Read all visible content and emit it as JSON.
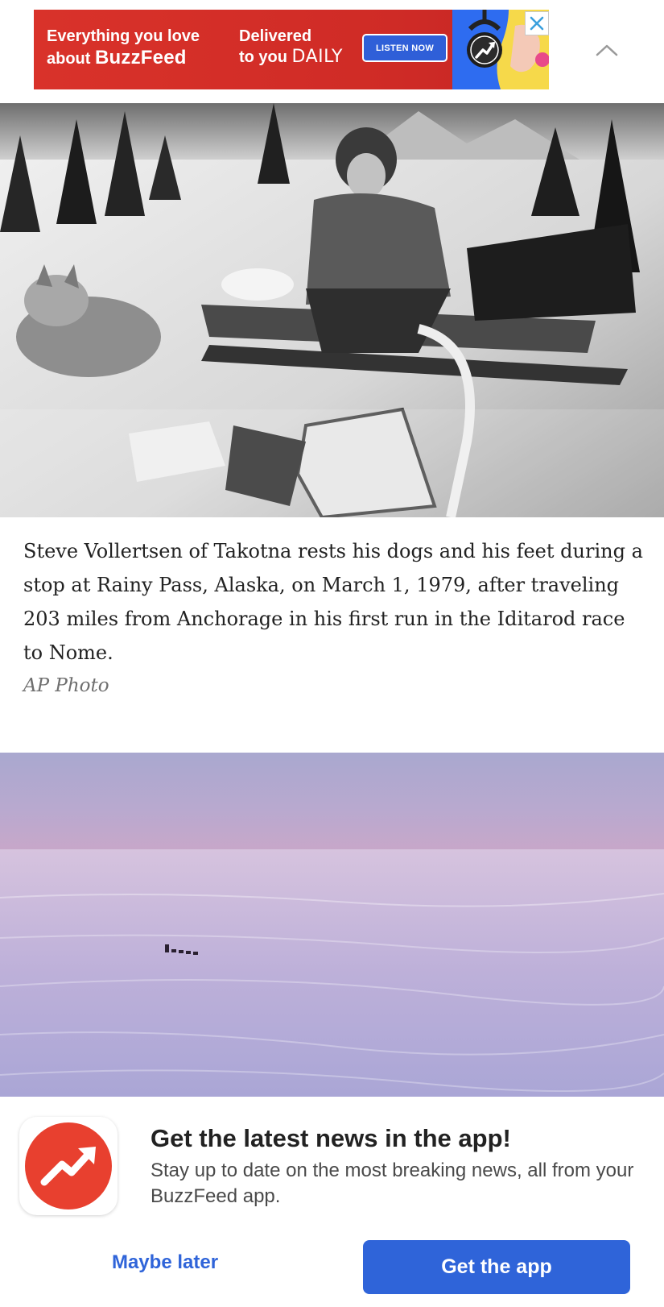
{
  "ad": {
    "line1a": "Everything you love",
    "line1b": "about ",
    "brand": "BuzzFeed",
    "line2a": "Delivered",
    "line2b": "to you ",
    "daily": "DAILY",
    "cta": "LISTEN NOW"
  },
  "icons": {
    "close": "close-icon",
    "collapse": "chevron-up-icon",
    "app": "buzzfeed-trending-arrow-icon"
  },
  "article": {
    "caption": "Steve Vollertsen of Takotna rests his dogs and his feet during a stop at Rainy Pass, Alaska, on March 1, 1979, after traveling 203 miles from Anchorage in his first run in the Iditarod race to Nome.",
    "credit": "AP Photo"
  },
  "promo": {
    "title": "Get the latest news in the app!",
    "subtitle": "Stay up to date on the most breaking news, all from your BuzzFeed app.",
    "maybe_label": "Maybe later",
    "get_label": "Get the app"
  },
  "colors": {
    "ad_red": "#d9322a",
    "cta_blue": "#2f64d9",
    "brand_red": "#e8402f"
  }
}
